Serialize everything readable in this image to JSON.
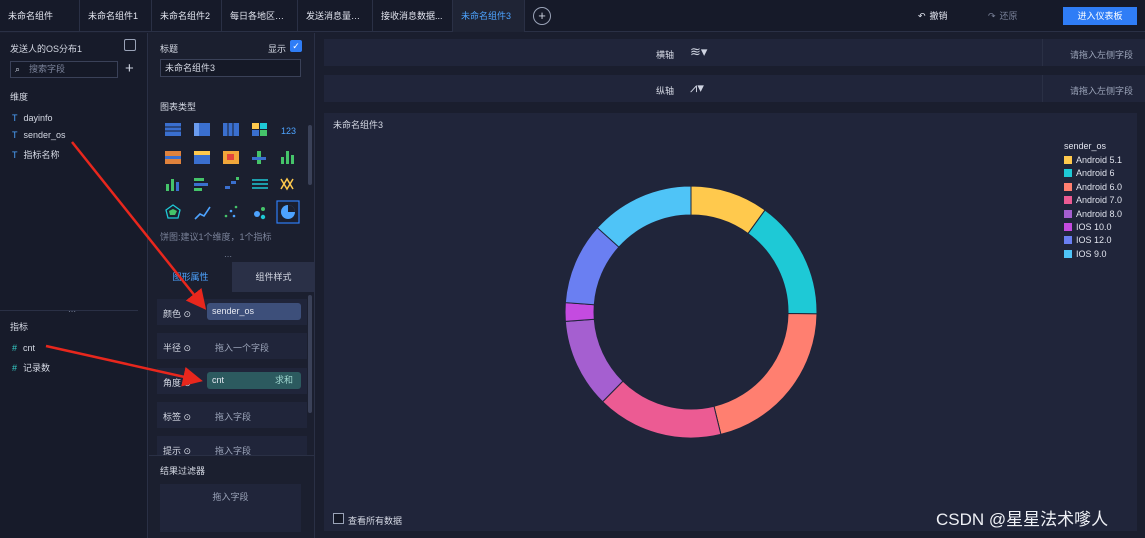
{
  "tabs": [
    {
      "label": "未命名组件"
    },
    {
      "label": "未命名组件1"
    },
    {
      "label": "未命名组件2"
    },
    {
      "label": "每日各地区发..."
    },
    {
      "label": "发送消息量最..."
    },
    {
      "label": "接收消息数据..."
    },
    {
      "label": "未命名组件3"
    }
  ],
  "toolbar": {
    "undo": "撤销",
    "redo": "还原",
    "enter": "进入仪表板"
  },
  "left": {
    "dataset_title": "发送人的OS分布1",
    "search_placeholder": "搜索字段",
    "dim_title": "维度",
    "dimensions": [
      "dayinfo",
      "sender_os",
      "指标名称"
    ],
    "measure_title": "指标",
    "measures": [
      "cnt",
      "记录数"
    ]
  },
  "mid": {
    "title_label": "标题",
    "show_label": "显示",
    "title_value": "未命名组件3",
    "chart_type_label": "图表类型",
    "pie_hint": "饼图:建议1个维度，1个指标",
    "tab_props": "图形属性",
    "tab_style": "组件样式",
    "slots": [
      {
        "label": "颜色",
        "value": "sender_os",
        "kind": "pill"
      },
      {
        "label": "半径",
        "value": "拖入一个字段",
        "kind": "ph"
      },
      {
        "label": "角度",
        "value": "cnt",
        "agg": "求和",
        "kind": "pill2"
      },
      {
        "label": "标签",
        "value": "拖入字段",
        "kind": "ph"
      },
      {
        "label": "提示",
        "value": "拖入字段",
        "kind": "ph"
      }
    ],
    "filter_title": "结果过滤器",
    "filter_placeholder": "拖入字段"
  },
  "axes": {
    "x_label": "横轴",
    "y_label": "纵轴",
    "x_hint": "请拖入左侧字段",
    "y_hint": "请拖入左侧字段"
  },
  "chart": {
    "title": "未命名组件3",
    "show_all": "查看所有数据",
    "watermark": "CSDN @星星法术嗲人"
  },
  "chart_data": {
    "type": "pie",
    "legend_title": "sender_os",
    "legend_position": "right",
    "categories": [
      "Android 5.1",
      "Android 6",
      "Android 6.0",
      "Android 7.0",
      "Android 8.0",
      "IOS 10.0",
      "IOS 12.0",
      "IOS 9.0"
    ],
    "values": [
      10.5,
      16,
      22,
      17,
      12,
      2.5,
      11,
      14
    ],
    "colors": [
      "#ffc94d",
      "#1ec9d6",
      "#ff7f70",
      "#ec5b93",
      "#a55fd0",
      "#c44be0",
      "#6a7ff2",
      "#4fc4f7"
    ]
  }
}
